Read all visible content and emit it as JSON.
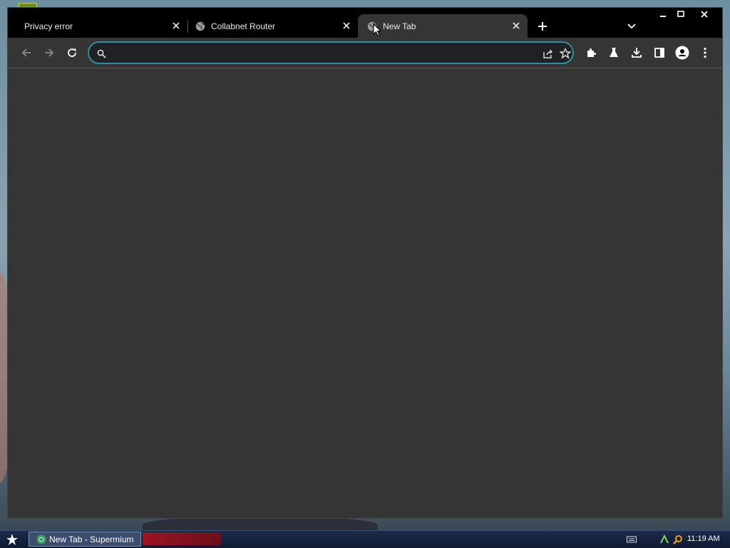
{
  "browser": {
    "tabs": [
      {
        "title": "Privacy error",
        "favicon": "none",
        "active": false
      },
      {
        "title": "Collabnet Router",
        "favicon": "globe-icon",
        "active": false
      },
      {
        "title": "New Tab",
        "favicon": "globe-icon",
        "active": true
      }
    ],
    "new_tab_button": "new-tab-icon",
    "omnibox": {
      "value": "",
      "placeholder": ""
    },
    "accent_color": "#2f8f9d",
    "tab_color": "#353535",
    "frame_color": "#000000"
  },
  "taskbar": {
    "window_button_title": "New Tab - Supermium",
    "clock": "11:19 AM"
  }
}
